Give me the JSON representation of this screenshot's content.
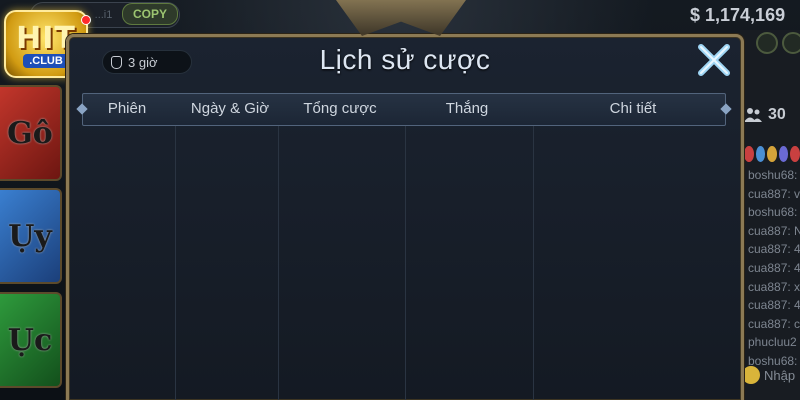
{
  "top_bar": {
    "hash_text": "f65d... ...i1",
    "copy_label": "COPY",
    "balance": "$ 1,174,169"
  },
  "logo": {
    "main": "HIT",
    "sub": ".CLUB"
  },
  "left_panels": [
    "Gô",
    "Ụy",
    "Ục"
  ],
  "right_panel": {
    "user_count": "30 ",
    "chat_lines": [
      "boshu68:",
      "cua887: v",
      "boshu68:",
      "cua887: N",
      "cua887: 4",
      "cua887: 4",
      "cua887: x",
      "cua887: 4",
      "cua887: c",
      "phucluu2",
      "boshu68:"
    ],
    "chat_placeholder": "Nhập"
  },
  "modal": {
    "timer_label": "3 giờ",
    "title": "Lịch sử cược",
    "columns": [
      "Phiên",
      "Ngày & Giờ",
      "Tổng cược",
      "Thắng",
      "Chi tiết"
    ],
    "rows": []
  },
  "colors": {
    "frame_gold": "#8c7a54",
    "panel_bg": "#141a23",
    "close_icon": "#9fd6f5"
  }
}
